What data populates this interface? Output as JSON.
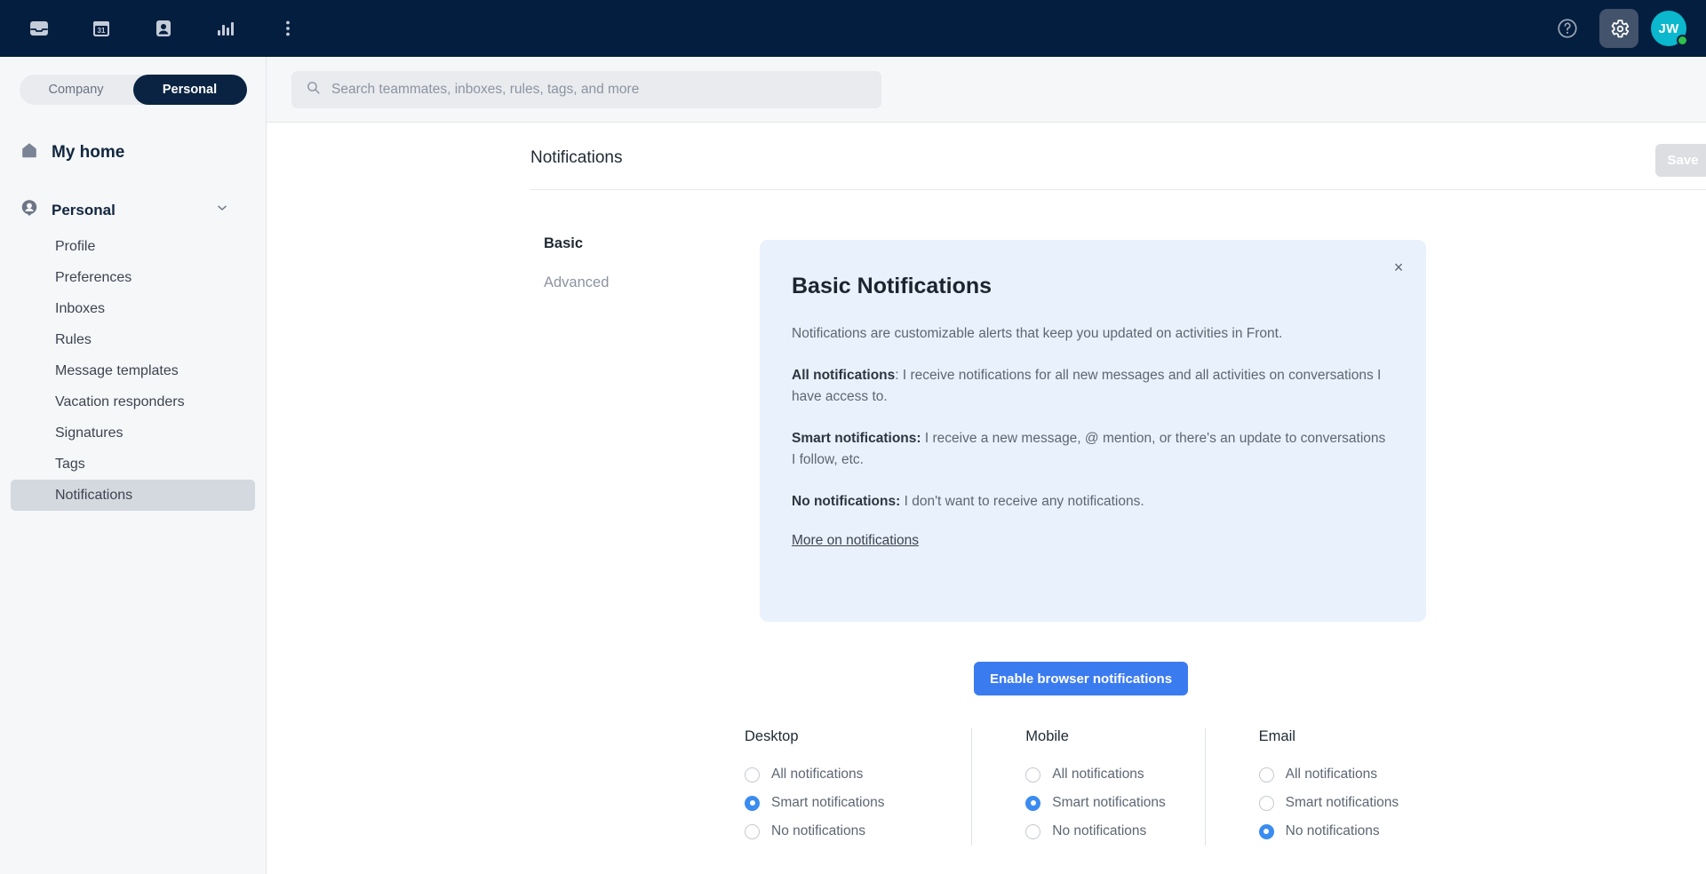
{
  "topbar": {
    "left_icons": [
      {
        "name": "inbox-icon",
        "label": "Inbox"
      },
      {
        "name": "calendar-icon",
        "label": "Calendar",
        "day": "31"
      },
      {
        "name": "contacts-icon",
        "label": "Contacts"
      },
      {
        "name": "analytics-icon",
        "label": "Analytics"
      },
      {
        "name": "more-icon",
        "label": "More"
      }
    ],
    "help_label": "?",
    "settings_label": "Settings",
    "avatar_initials": "JW"
  },
  "sidebar": {
    "segments": [
      {
        "label": "Company",
        "active": false
      },
      {
        "label": "Personal",
        "active": true
      }
    ],
    "home_label": "My home",
    "group_label": "Personal",
    "items": [
      {
        "label": "Profile",
        "active": false
      },
      {
        "label": "Preferences",
        "active": false
      },
      {
        "label": "Inboxes",
        "active": false
      },
      {
        "label": "Rules",
        "active": false
      },
      {
        "label": "Message templates",
        "active": false
      },
      {
        "label": "Vacation responders",
        "active": false
      },
      {
        "label": "Signatures",
        "active": false
      },
      {
        "label": "Tags",
        "active": false
      },
      {
        "label": "Notifications",
        "active": true
      }
    ]
  },
  "search": {
    "placeholder": "Search teammates, inboxes, rules, tags, and more",
    "value": ""
  },
  "page": {
    "title": "Notifications",
    "save_label": "Save"
  },
  "subnav": [
    {
      "label": "Basic",
      "active": true
    },
    {
      "label": "Advanced",
      "active": false
    }
  ],
  "info_panel": {
    "close_label": "×",
    "title": "Basic Notifications",
    "intro": "Notifications are customizable alerts that keep you updated on activities in Front.",
    "items": [
      {
        "term": "All notifications",
        "sep": ": ",
        "desc": "I receive notifications for all new messages and all activities on conversations I have access to."
      },
      {
        "term": "Smart notifications:",
        "sep": " ",
        "desc": "I receive a new message, @ mention, or there's an update to conversations I follow, etc."
      },
      {
        "term": "No notifications:",
        "sep": " ",
        "desc": "I don't want to receive any notifications."
      }
    ],
    "link_label": "More on notifications"
  },
  "enable_button": {
    "label": "Enable browser notifications"
  },
  "columns": [
    {
      "title": "Desktop",
      "options": [
        {
          "label": "All notifications",
          "checked": false
        },
        {
          "label": "Smart notifications",
          "checked": true
        },
        {
          "label": "No notifications",
          "checked": false
        }
      ]
    },
    {
      "title": "Mobile",
      "options": [
        {
          "label": "All notifications",
          "checked": false
        },
        {
          "label": "Smart notifications",
          "checked": true
        },
        {
          "label": "No notifications",
          "checked": false
        }
      ]
    },
    {
      "title": "Email",
      "options": [
        {
          "label": "All notifications",
          "checked": false
        },
        {
          "label": "Smart notifications",
          "checked": false
        },
        {
          "label": "No notifications",
          "checked": true
        }
      ]
    }
  ],
  "colors": {
    "topbar": "#041e3f",
    "accent_blue": "#3b7bf0",
    "radio_blue": "#3b8cf0",
    "avatar": "#0bb8cd",
    "status_dot": "#2ec14b",
    "info_panel_bg": "#e9f1fd",
    "sidebar_bg": "#f6f7f9",
    "active_item_bg": "#d4d9e0"
  }
}
